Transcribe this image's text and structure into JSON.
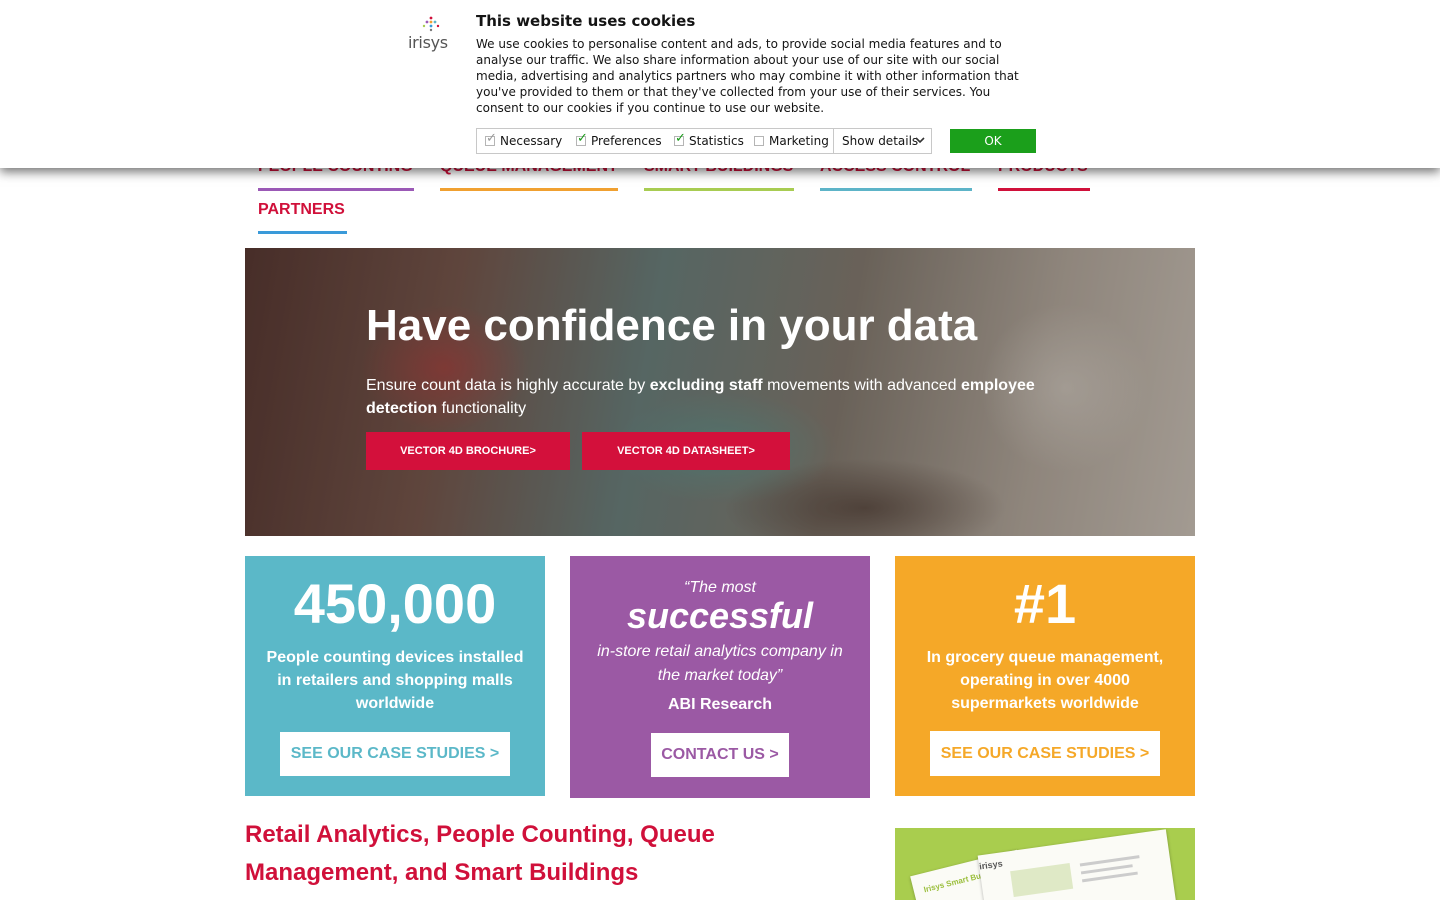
{
  "cookie_banner": {
    "logo_text": "irisys",
    "title": "This website uses cookies",
    "text": "We use cookies to personalise content and ads, to provide social media features and to analyse our traffic. We also share information about your use of our site with our social media, advertising and analytics partners who may combine it with other information that you've provided to them or that they've collected from your use of their services. You consent to our cookies if you continue to use our website.",
    "options": [
      {
        "label": "Necessary",
        "checked": true,
        "disabled": true
      },
      {
        "label": "Preferences",
        "checked": true
      },
      {
        "label": "Statistics",
        "checked": true
      },
      {
        "label": "Marketing",
        "checked": false
      }
    ],
    "details_label": "Show details",
    "ok_label": "OK"
  },
  "nav": {
    "items": [
      {
        "label": "PEOPLE COUNTING",
        "color": "#9b59b6"
      },
      {
        "label": "QUEUE MANAGEMENT",
        "color": "#f0a030"
      },
      {
        "label": "SMART BUILDINGS",
        "color": "#a8cc52"
      },
      {
        "label": "ACCESS CONTROL",
        "color": "#5db4c8"
      },
      {
        "label": "PRODUCTS",
        "color": "#d0103a"
      },
      {
        "label": "PARTNERS",
        "color": "#3a9ad9"
      }
    ]
  },
  "hero": {
    "title": "Have confidence in your data",
    "sub": {
      "t1": "Ensure count data is highly accurate by ",
      "b1": "excluding staff",
      "t2": " movements with advanced ",
      "b2": "employee detection",
      "t3": " functionality"
    },
    "buttons": [
      "VECTOR 4D BROCHURE>",
      "VECTOR 4D DATASHEET>"
    ]
  },
  "boxes": {
    "b1": {
      "big": "450,000",
      "desc": "People counting devices installed in retailers and shopping malls worldwide",
      "button": "SEE OUR CASE STUDIES >",
      "color": "#5bb8c8"
    },
    "b2": {
      "quote_open": "“The most",
      "quote_big": "successful",
      "quote_rest": "in-store retail analytics company in the market today”",
      "source": "ABI Research",
      "button": "CONTACT US >",
      "color": "#9b59a4"
    },
    "b3": {
      "big": "#1",
      "desc": "In grocery queue management, operating in over 4000 supermarkets worldwide",
      "button": "SEE OUR CASE STUDIES >",
      "color": "#f5a828"
    }
  },
  "bottom": {
    "heading": "Retail Analytics, People Counting, Queue Management, and Smart Buildings",
    "brochure_logo": "irisys",
    "brochure_title": "Irisys Smart Buildings"
  }
}
